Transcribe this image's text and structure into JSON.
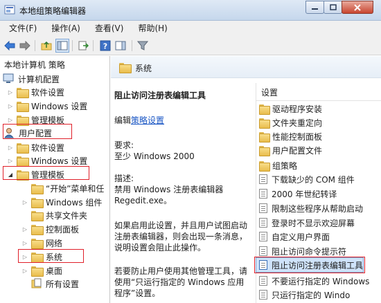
{
  "window": {
    "title": "本地组策略编辑器"
  },
  "menu": [
    "文件(F)",
    "操作(A)",
    "查看(V)",
    "帮助(H)"
  ],
  "tree": {
    "root": "本地计算机 策略",
    "computer_config": "计算机配置",
    "computer_children": [
      "软件设置",
      "Windows 设置",
      "管理模板"
    ],
    "user_config": "用户配置",
    "user_children": [
      "软件设置",
      "Windows 设置",
      "管理模板"
    ],
    "admin_template_children": [
      "“开始”菜单和任",
      "Windows 组件",
      "共享文件夹",
      "控制面板",
      "网络",
      "系统",
      "桌面",
      "所有设置"
    ]
  },
  "detail": {
    "header": "系统",
    "setting_title": "阻止访问注册表编辑工具",
    "edit_prefix": "编辑",
    "edit_link": "策略设置",
    "req_label": "要求:",
    "req_value": "至少 Windows 2000",
    "desc_label": "描述:",
    "desc_lines": [
      "禁用 Windows 注册表编辑器",
      "Regedit.exe。"
    ],
    "para1": [
      "如果启用此设置，并且用户试图启动",
      "注册表编辑器，则会出现一条消息，",
      "说明设置会阻止此操作。"
    ],
    "para2": [
      "若要防止用户使用其他管理工具，请",
      "使用“只运行指定的 Windows 应用",
      "程序”设置。"
    ]
  },
  "settings": {
    "header": "设置",
    "folders": [
      "驱动程序安装",
      "文件夹重定向",
      "性能控制面板",
      "用户配置文件",
      "组策略"
    ],
    "items": [
      "下载缺少的 COM 组件",
      "2000 年世纪转译",
      "限制这些程序从帮助启动",
      "登录时不显示欢迎屏幕",
      "自定义用户界面",
      "阻止访问命令提示符",
      "阻止访问注册表编辑工具",
      "不要运行指定的 Windows",
      "只运行指定的 Windo"
    ]
  }
}
